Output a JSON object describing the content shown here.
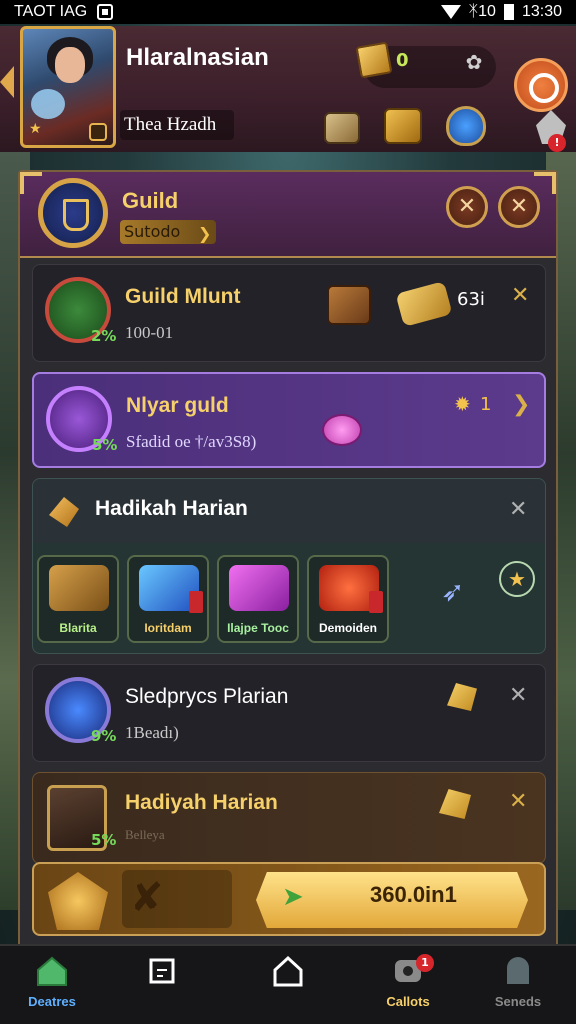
{
  "status_bar": {
    "left_text": "TAOT ІАG",
    "time": "13:30",
    "signal_text": "ᛡ10"
  },
  "header": {
    "player_name": "Hlaralnasian",
    "player_subtitle": "Thea Hzadh",
    "gold_value": "0"
  },
  "guild": {
    "title": "Guild",
    "subtitle": "Sutodo"
  },
  "rows": [
    {
      "title": "Guild Mlunt",
      "subtitle": "100-01",
      "percent": "2%",
      "value": "63i"
    },
    {
      "title": "Nlyar guld",
      "subtitle": "Sfadid oe †/av3S8)",
      "percent": "5%",
      "value": "1"
    },
    {
      "title": "Hadikah Harian"
    },
    {
      "title": "Sledprycs Plarian",
      "subtitle": "1Beadı)",
      "percent": "9%"
    },
    {
      "title": "Hadiyah Harian",
      "subtitle": "Belleya",
      "percent": "5%"
    }
  ],
  "items": [
    {
      "label": "Blarita"
    },
    {
      "label": "Ioritdam"
    },
    {
      "label": "Ilajpe Tooc"
    },
    {
      "label": "Demoiden"
    }
  ],
  "claim": {
    "label": "360.0in1"
  },
  "nav": [
    {
      "label": "Deatres"
    },
    {
      "label": ""
    },
    {
      "label": ""
    },
    {
      "label": "Callots",
      "badge": "1"
    },
    {
      "label": "Seneds"
    }
  ],
  "colors": {
    "accent_gold": "#f6d06a",
    "panel_purple": "#5a2c5e",
    "green_text": "#75d95a"
  }
}
